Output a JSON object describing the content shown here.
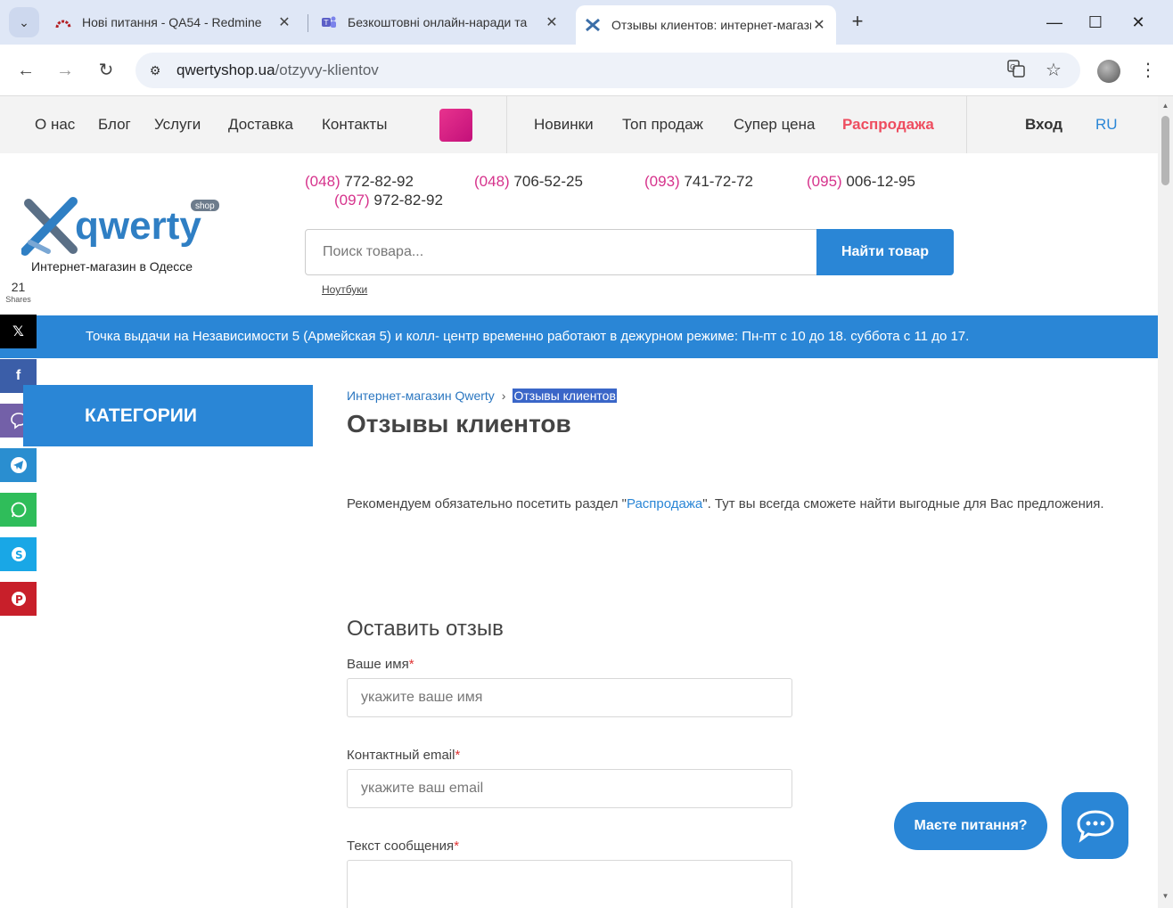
{
  "browser": {
    "tabs": [
      {
        "title": "Нові питання - QA54 - Redmine"
      },
      {
        "title": "Безкоштовні онлайн-наради та"
      },
      {
        "title": "Отзывы клиентов: интернет-магазин"
      }
    ],
    "url_host": "qwertyshop.ua",
    "url_path": "/otzyvy-klientov"
  },
  "nav": {
    "left": [
      "О нас",
      "Блог",
      "Услуги",
      "Доставка",
      "Контакты"
    ],
    "mid": [
      "Новинки",
      "Топ продаж",
      "Супер цена"
    ],
    "sale": "Распродажа",
    "login": "Вход",
    "lang": "RU"
  },
  "header": {
    "logo_text": "qwerty",
    "logo_badge": "shop",
    "logo_sub": "Интернет-магазин в Одессе",
    "phones": [
      {
        "code": "(048)",
        "num": " 772-82-92"
      },
      {
        "code": "(048)",
        "num": " 706-52-25"
      },
      {
        "code": "(093)",
        "num": " 741-72-72"
      },
      {
        "code": "(095)",
        "num": " 006-12-95"
      },
      {
        "code": "(097)",
        "num": " 972-82-92"
      }
    ],
    "search_placeholder": "Поиск товара...",
    "search_button": "Найти товар",
    "search_hint": "Ноутбуки"
  },
  "banner": "Точка выдачи на Независимости 5 (Армейская 5) и колл- центр временно работают в дежурном режиме: Пн-пт с 10 до 18. суббота с 11 до 17.",
  "share": {
    "count": "21",
    "label": "Shares"
  },
  "sidebar": {
    "categories": "КАТЕГОРИИ"
  },
  "breadcrumb": {
    "home": "Интернет-магазин Qwerty",
    "current": "Отзывы клиентов"
  },
  "page_title": "Отзывы клиентов",
  "intro": {
    "before": "Рекомендуем обязательно посетить раздел \"",
    "link": "Распродажа",
    "after": "\". Тут вы всегда сможете найти выгодные для Вас предложения."
  },
  "form": {
    "title": "Оставить отзыв",
    "name_label": "Ваше имя",
    "name_placeholder": "укажите ваше имя",
    "email_label": "Контактный email",
    "email_placeholder": "укажите ваш email",
    "text_label": "Текст сообщения",
    "required_mark": "*"
  },
  "chat": {
    "bubble": "Маєте питання?"
  },
  "colors": {
    "accent": "#2a86d6",
    "sale": "#ee4d5f",
    "phone_code": "#d6338c"
  }
}
